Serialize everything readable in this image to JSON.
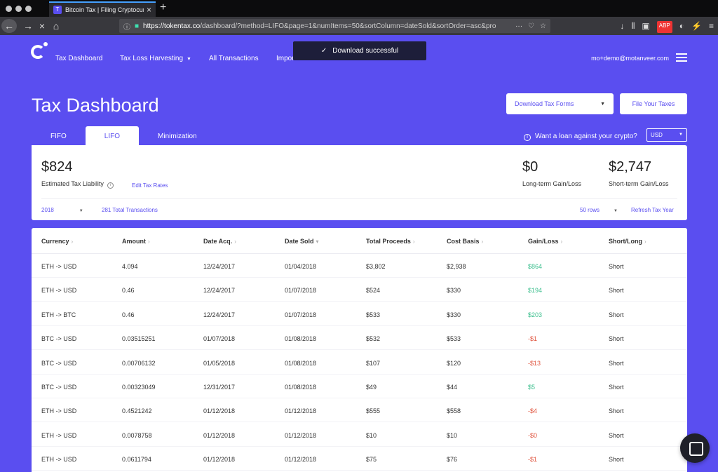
{
  "browser": {
    "tab_title": "Bitcoin Tax | Filing Cryptocurrenc",
    "url_host": "https://tokentax.co",
    "url_path": "/dashboard/?method=LIFO&page=1&numItems=50&sortColumn=dateSold&sortOrder=asc&pro"
  },
  "nav": {
    "links": [
      "Tax Dashboard",
      "Tax Loss Harvesting",
      "All Transactions",
      "Import Data"
    ],
    "email": "mo+demo@motanveer.com"
  },
  "toast": {
    "text": "Download successful"
  },
  "header": {
    "title": "Tax Dashboard",
    "download_label": "Download Tax Forms",
    "file_label": "File Your Taxes"
  },
  "tabs": [
    "FIFO",
    "LIFO",
    "Minimization"
  ],
  "active_tab": "LIFO",
  "loan_text": "Want a loan against your crypto?",
  "currency": "USD",
  "summary": {
    "liability_value": "$824",
    "liability_label": "Estimated Tax Liability",
    "edit_rates": "Edit Tax Rates",
    "long_value": "$0",
    "long_label": "Long-term Gain/Loss",
    "short_value": "$2,747",
    "short_label": "Short-term Gain/Loss",
    "year": "2018",
    "total_tx": "281 Total Transactions",
    "rows": "50 rows",
    "refresh": "Refresh Tax Year"
  },
  "table": {
    "columns": [
      "Currency",
      "Amount",
      "Date Acq.",
      "Date Sold",
      "Total Proceeds",
      "Cost Basis",
      "Gain/Loss",
      "Short/Long"
    ],
    "sort_glyphs": [
      "›",
      "›",
      "›",
      "▾",
      "›",
      "›",
      "›",
      "›"
    ],
    "rows": [
      {
        "currency": "ETH -> USD",
        "amount": "4.094",
        "acq": "12/24/2017",
        "sold": "01/04/2018",
        "proceeds": "$3,802",
        "basis": "$2,938",
        "gain": "$864",
        "term": "Short",
        "sign": "pos"
      },
      {
        "currency": "ETH -> USD",
        "amount": "0.46",
        "acq": "12/24/2017",
        "sold": "01/07/2018",
        "proceeds": "$524",
        "basis": "$330",
        "gain": "$194",
        "term": "Short",
        "sign": "pos"
      },
      {
        "currency": "ETH -> BTC",
        "amount": "0.46",
        "acq": "12/24/2017",
        "sold": "01/07/2018",
        "proceeds": "$533",
        "basis": "$330",
        "gain": "$203",
        "term": "Short",
        "sign": "pos"
      },
      {
        "currency": "BTC -> USD",
        "amount": "0.03515251",
        "acq": "01/07/2018",
        "sold": "01/08/2018",
        "proceeds": "$532",
        "basis": "$533",
        "gain": "-$1",
        "term": "Short",
        "sign": "neg"
      },
      {
        "currency": "BTC -> USD",
        "amount": "0.00706132",
        "acq": "01/05/2018",
        "sold": "01/08/2018",
        "proceeds": "$107",
        "basis": "$120",
        "gain": "-$13",
        "term": "Short",
        "sign": "neg"
      },
      {
        "currency": "BTC -> USD",
        "amount": "0.00323049",
        "acq": "12/31/2017",
        "sold": "01/08/2018",
        "proceeds": "$49",
        "basis": "$44",
        "gain": "$5",
        "term": "Short",
        "sign": "pos"
      },
      {
        "currency": "ETH -> USD",
        "amount": "0.4521242",
        "acq": "01/12/2018",
        "sold": "01/12/2018",
        "proceeds": "$555",
        "basis": "$558",
        "gain": "-$4",
        "term": "Short",
        "sign": "neg"
      },
      {
        "currency": "ETH -> USD",
        "amount": "0.0078758",
        "acq": "01/12/2018",
        "sold": "01/12/2018",
        "proceeds": "$10",
        "basis": "$10",
        "gain": "-$0",
        "term": "Short",
        "sign": "neg"
      },
      {
        "currency": "ETH -> USD",
        "amount": "0.0611794",
        "acq": "01/12/2018",
        "sold": "01/12/2018",
        "proceeds": "$75",
        "basis": "$76",
        "gain": "-$1",
        "term": "Short",
        "sign": "neg"
      }
    ]
  },
  "colors": {
    "brand": "#5a4ef0",
    "positive": "#3cbf8e",
    "negative": "#e0533d"
  }
}
